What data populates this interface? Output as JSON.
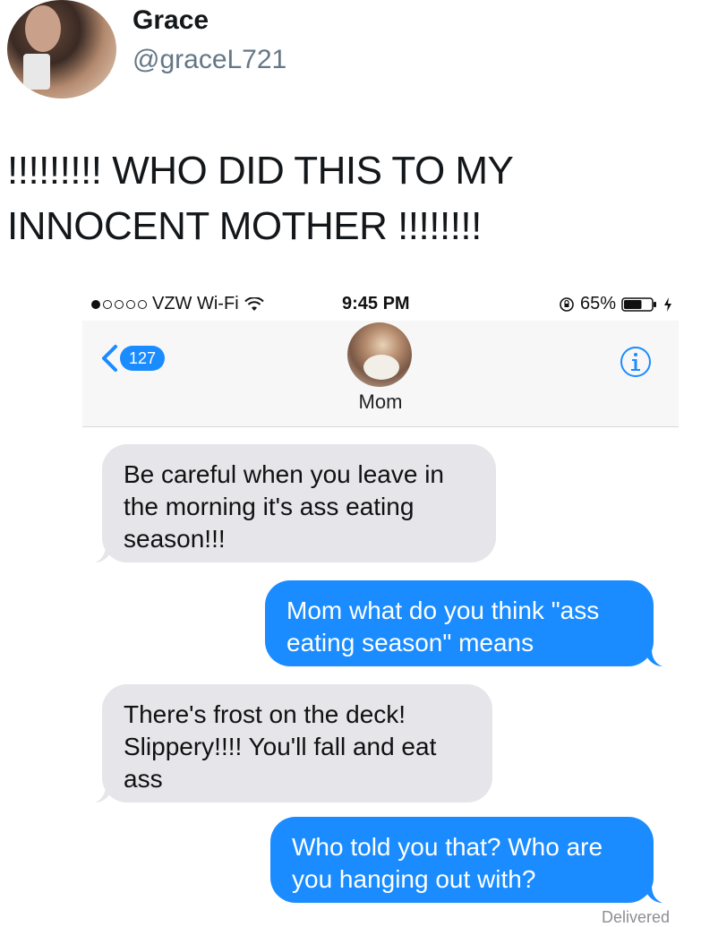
{
  "tweet": {
    "name": "Grace",
    "handle": "@graceL721",
    "text": "!!!!!!!!! WHO DID THIS TO MY INNOCENT MOTHER !!!!!!!!"
  },
  "phone": {
    "status": {
      "carrier": "VZW Wi-Fi",
      "time": "9:45 PM",
      "battery": "65%",
      "battery_level": 0.65
    },
    "nav": {
      "back_count": "127",
      "contact_name": "Mom"
    },
    "messages": [
      {
        "from": "contact",
        "text": "Be careful when you leave in the morning it's ass eating season!!!"
      },
      {
        "from": "me",
        "text": "Mom what do you think \"ass eating season\" means"
      },
      {
        "from": "contact",
        "text": "There's frost on the deck! Slippery!!!! You'll fall and eat ass"
      },
      {
        "from": "me",
        "text": "Who told you that? Who are you hanging out with?"
      }
    ],
    "delivered_label": "Delivered"
  },
  "colors": {
    "imessage_blue": "#1a8cff",
    "incoming_gray": "#e5e5ea",
    "handle_gray": "#657786"
  },
  "icons": [
    "wifi-icon",
    "lock-rotation-icon",
    "battery-icon",
    "charging-bolt-icon",
    "back-chevron-icon",
    "info-icon"
  ]
}
